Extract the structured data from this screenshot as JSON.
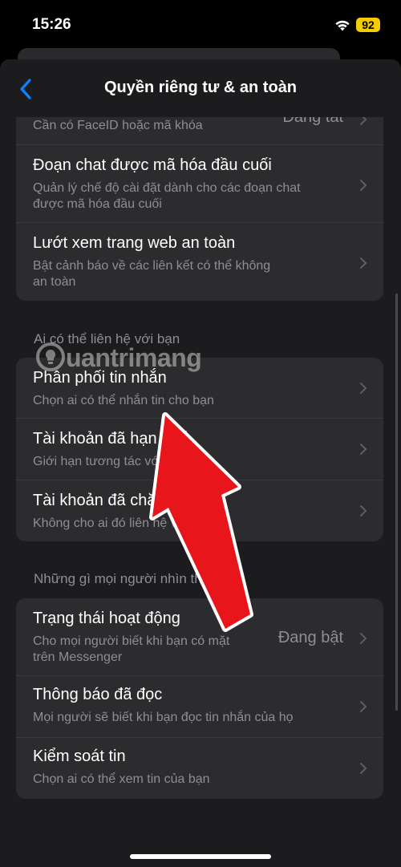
{
  "status": {
    "time": "15:26",
    "battery": "92",
    "wifi_icon": "wifi-icon"
  },
  "nav": {
    "title": "Quyền riêng tư & an toàn",
    "back_icon": "chevron-left-icon"
  },
  "top_group": {
    "rows": [
      {
        "subtitle_line1": "Cần có FaceID hoặc mã khóa",
        "value": "Đang tắt"
      },
      {
        "title": "Đoạn chat được mã hóa đầu cuối",
        "subtitle_line1": "Quản lý chế độ cài đặt dành cho các đoạn chat",
        "subtitle_line2": "được mã hóa đầu cuối"
      },
      {
        "title": "Lướt xem trang web an toàn",
        "subtitle_line1": "Bật cảnh báo về các liên kết có thể không",
        "subtitle_line2": "an toàn"
      }
    ]
  },
  "contact_section": {
    "label": "Ai có thể liên hệ với bạn",
    "rows": [
      {
        "title": "Phân phối tin nhắn",
        "subtitle": "Chọn ai có thể nhắn tin cho bạn"
      },
      {
        "title": "Tài khoản đã hạn chế",
        "subtitle": "Giới hạn tương tác với ai đó"
      },
      {
        "title": "Tài khoản đã chặn",
        "subtitle": "Không cho ai đó liên hệ với bạn"
      }
    ]
  },
  "visibility_section": {
    "label": "Những gì mọi người nhìn thấy",
    "rows": [
      {
        "title": "Trạng thái hoạt động",
        "subtitle_line1": "Cho mọi người biết khi bạn có mặt",
        "subtitle_line2": "trên Messenger",
        "value": "Đang bật"
      },
      {
        "title": "Thông báo đã đọc",
        "subtitle": "Mọi người sẽ biết khi bạn đọc tin nhắn của họ"
      },
      {
        "title": "Kiểm soát tin",
        "subtitle": "Chọn ai có thể xem tin của bạn"
      }
    ]
  },
  "watermark": {
    "text": "uantrimang"
  },
  "colors": {
    "accent": "#0a84ff",
    "arrow_red": "#e8151b",
    "battery": "#f5cc00"
  }
}
